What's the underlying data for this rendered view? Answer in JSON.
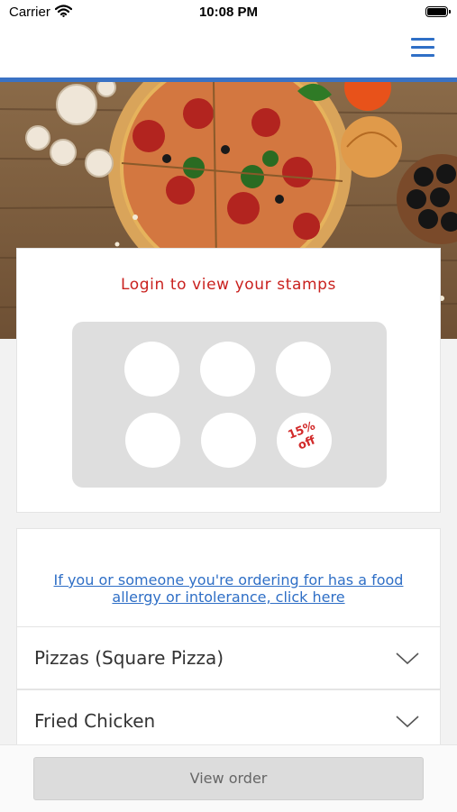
{
  "status_bar": {
    "carrier": "Carrier",
    "time": "10:08 PM",
    "icons": [
      "wifi-icon",
      "battery-icon"
    ]
  },
  "header": {
    "menu_icon": "hamburger-menu-icon",
    "accent_color": "#3a72c4"
  },
  "hero": {
    "image": "pizza-on-wooden-table"
  },
  "stamps": {
    "login_text": "Login to view your stamps",
    "login_color": "#c9211e",
    "total_stamps": 6,
    "reward_line1": "15%",
    "reward_line2": "off"
  },
  "allergy": {
    "link_text": "If you or someone you're ordering for has a food allergy or intolerance, click here",
    "link_color": "#2f6fc6"
  },
  "menu": {
    "categories": [
      {
        "label": "Pizzas (Square Pizza)",
        "icon": "chevron-down-icon"
      },
      {
        "label": "Fried Chicken",
        "icon": "chevron-down-icon"
      }
    ]
  },
  "footer": {
    "view_order_label": "View order"
  }
}
